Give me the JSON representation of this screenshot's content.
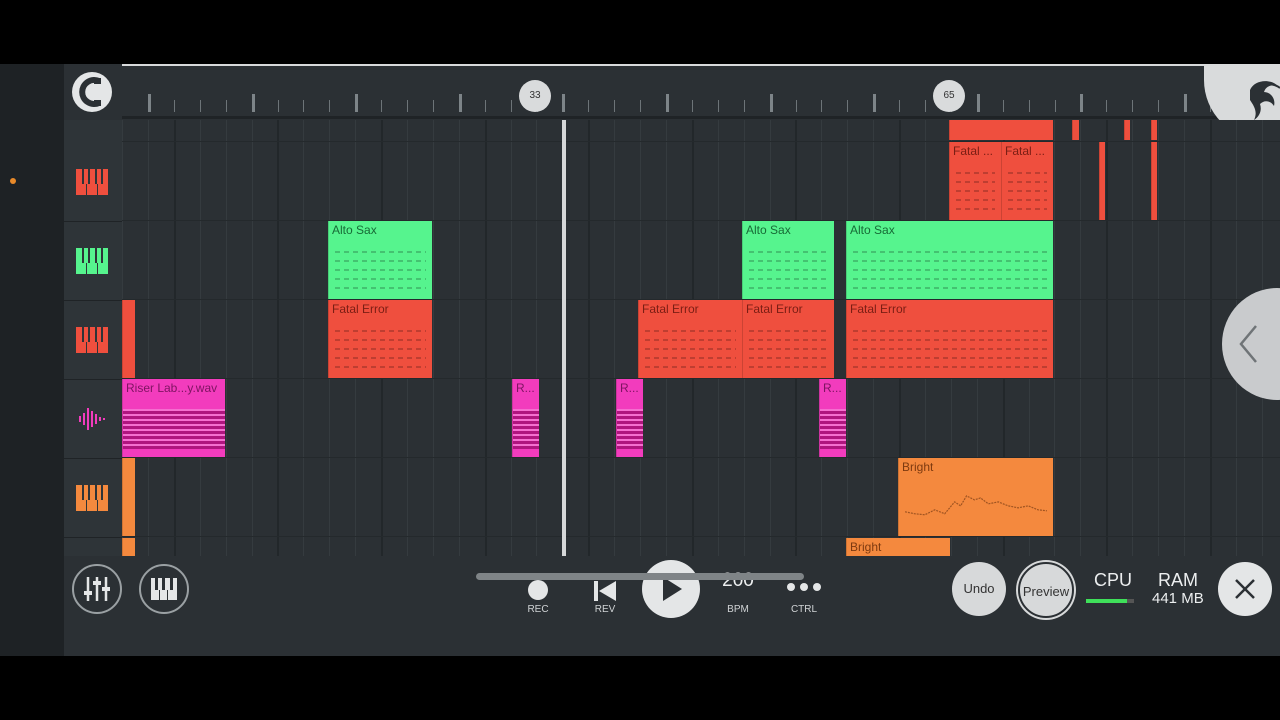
{
  "timeline": {
    "markers": [
      {
        "bar": "33"
      },
      {
        "bar": "65"
      }
    ]
  },
  "tracks": [
    {
      "type": "instrument",
      "color": "#ef4f3e",
      "icon": "piano-keys-icon"
    },
    {
      "type": "instrument",
      "color": "#56f48e",
      "icon": "piano-keys-icon"
    },
    {
      "type": "instrument",
      "color": "#ef4f3e",
      "icon": "piano-keys-icon"
    },
    {
      "type": "audio",
      "color": "#f23cbd",
      "icon": "waveform-icon"
    },
    {
      "type": "instrument",
      "color": "#f4893e",
      "icon": "piano-keys-icon"
    }
  ],
  "clips": {
    "fatal_1": "Fatal ...",
    "fatal_2": "Fatal ...",
    "alto_sax_1": "Alto Sax",
    "alto_sax_2": "Alto Sax",
    "alto_sax_3": "Alto Sax",
    "fatal_error_1": "Fatal Error",
    "fatal_error_2": "Fatal Error",
    "fatal_error_3": "Fatal Error",
    "fatal_error_4": "Fatal Error",
    "riser": "Riser Lab...y.wav",
    "riser_short_1": "R...",
    "riser_short_2": "R...",
    "riser_short_3": "R...",
    "bright_1": "Bright",
    "bright_2": "Bright"
  },
  "transport": {
    "rec_label": "REC",
    "rev_label": "REV",
    "bpm": "200",
    "bpm_label": "BPM",
    "ctrl_label": "CTRL",
    "undo_label": "Undo",
    "preview_label": "Preview",
    "cpu_label": "CPU",
    "cpu_level": 0.85,
    "ram_label": "RAM",
    "ram_value": "441 MB"
  },
  "colors": {
    "red_clip": "#ef4f3e",
    "green_clip": "#56f48e",
    "pink_clip": "#f23cbd",
    "orange_clip": "#f4893e",
    "cpu_meter": "#3fe05a"
  }
}
